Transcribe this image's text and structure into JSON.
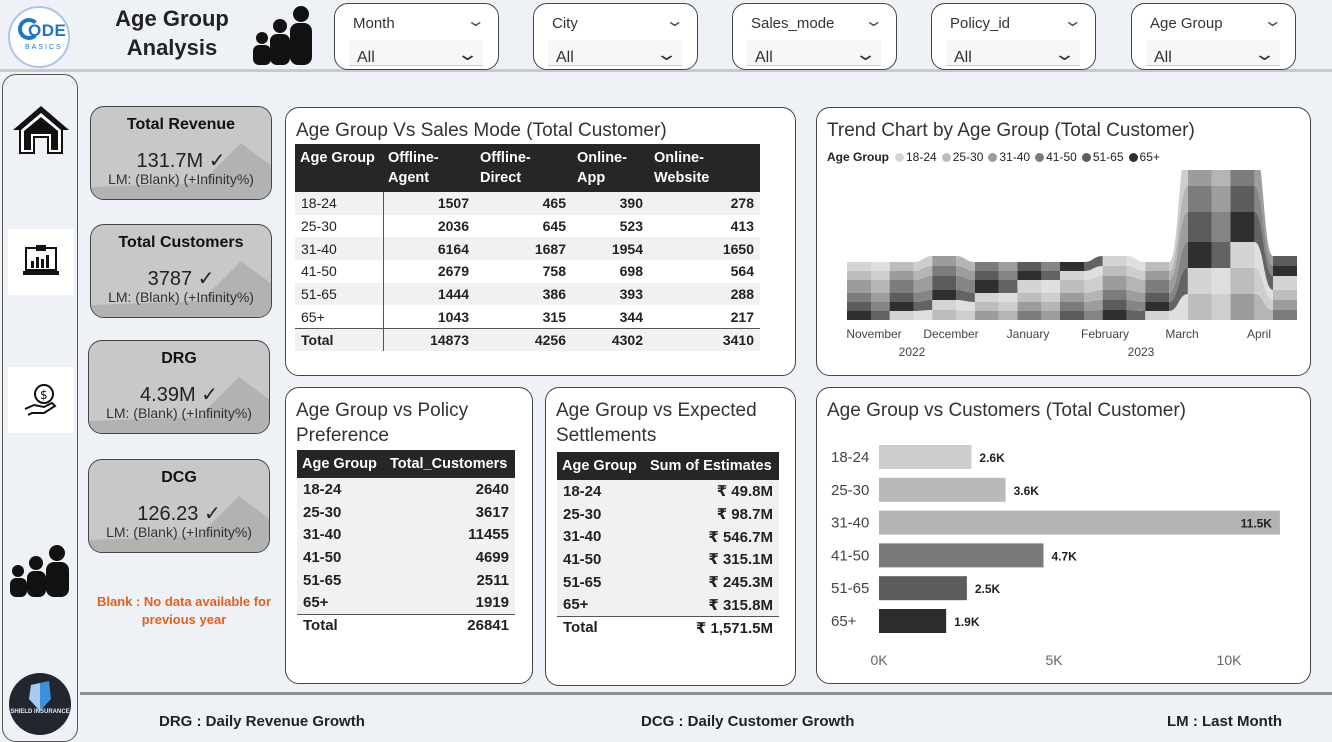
{
  "header": {
    "logo_text": "ODE",
    "logo_sub": "BASICS",
    "title": "Age Group Analysis",
    "slicers": [
      {
        "label": "Month",
        "value": "All"
      },
      {
        "label": "City",
        "value": "All"
      },
      {
        "label": "Sales_mode",
        "value": "All"
      },
      {
        "label": "Policy_id",
        "value": "All"
      },
      {
        "label": "Age Group",
        "value": "All"
      }
    ]
  },
  "sidebar": {
    "items": [
      {
        "icon": "home-icon"
      },
      {
        "icon": "kpi-dashboard-icon"
      },
      {
        "icon": "hand-money-icon"
      },
      {
        "icon": "age-group-icon"
      }
    ],
    "shield_label": "SHIELD INSURANCE"
  },
  "kpis": [
    {
      "title": "Total Revenue",
      "value": "131.7M",
      "lm": "LM: (Blank) (+Infinity%)"
    },
    {
      "title": "Total Customers",
      "value": "3787",
      "lm": "LM: (Blank) (+Infinity%)"
    },
    {
      "title": "DRG",
      "value": "4.39M",
      "lm": "LM: (Blank) (+Infinity%)"
    },
    {
      "title": "DCG",
      "value": "126.23",
      "lm": "LM: (Blank) (+Infinity%)"
    }
  ],
  "blank_note": "Blank : No data available for previous year",
  "sales_mode_table": {
    "title": "Age Group Vs Sales Mode (Total Customer)",
    "headers": [
      "Age Group",
      "Offline-Agent",
      "Offline-Direct",
      "Online-App",
      "Online-Website"
    ],
    "rows": [
      [
        "18-24",
        "1507",
        "465",
        "390",
        "278"
      ],
      [
        "25-30",
        "2036",
        "645",
        "523",
        "413"
      ],
      [
        "31-40",
        "6164",
        "1687",
        "1954",
        "1650"
      ],
      [
        "41-50",
        "2679",
        "758",
        "698",
        "564"
      ],
      [
        "51-65",
        "1444",
        "386",
        "393",
        "288"
      ],
      [
        "65+",
        "1043",
        "315",
        "344",
        "217"
      ]
    ],
    "total": [
      "Total",
      "14873",
      "4256",
      "4302",
      "3410"
    ]
  },
  "policy_table": {
    "title": "Age Group vs Policy Preference",
    "headers": [
      "Age Group",
      "Total_Customers"
    ],
    "rows": [
      [
        "18-24",
        "2640"
      ],
      [
        "25-30",
        "3617"
      ],
      [
        "31-40",
        "11455"
      ],
      [
        "41-50",
        "4699"
      ],
      [
        "51-65",
        "2511"
      ],
      [
        "65+",
        "1919"
      ]
    ],
    "total": [
      "Total",
      "26841"
    ]
  },
  "settlement_table": {
    "title": "Age Group vs Expected Settlements",
    "headers": [
      "Age Group",
      "Sum of Estimates"
    ],
    "rows": [
      [
        "18-24",
        "₹ 49.8M"
      ],
      [
        "25-30",
        "₹ 98.7M"
      ],
      [
        "31-40",
        "₹ 546.7M"
      ],
      [
        "41-50",
        "₹ 315.1M"
      ],
      [
        "51-65",
        "₹ 245.3M"
      ],
      [
        "65+",
        "₹ 315.8M"
      ]
    ],
    "total": [
      "Total",
      "₹ 1,571.5M"
    ]
  },
  "trend": {
    "title": "Trend Chart by Age Group (Total Customer)",
    "legend_title": "Age Group",
    "x_labels": [
      "November",
      "December",
      "January",
      "February",
      "March",
      "April"
    ],
    "year_labels": [
      "2022",
      "2023"
    ],
    "colors": [
      "#d4d4d4",
      "#bdbdbd",
      "#9c9c9c",
      "#7c7c7c",
      "#5c5c5c",
      "#2f2f2f"
    ]
  },
  "chart_data": {
    "type": "bar",
    "title": "Age Group vs Customers (Total Customer)",
    "categories": [
      "18-24",
      "25-30",
      "31-40",
      "41-50",
      "51-65",
      "65+"
    ],
    "values": [
      2640,
      3617,
      11455,
      4699,
      2511,
      1919
    ],
    "data_labels": [
      "2.6K",
      "3.6K",
      "11.5K",
      "4.7K",
      "2.5K",
      "1.9K"
    ],
    "colors": [
      "#cdcdcd",
      "#b9b9b9",
      "#b3b3b3",
      "#7a7a7a",
      "#5d5d5d",
      "#2c2c2c"
    ],
    "xticks": [
      "0K",
      "5K",
      "10K"
    ],
    "xtick_values": [
      0,
      5000,
      10000
    ],
    "xlim": [
      0,
      12000
    ],
    "legend": "none"
  },
  "footer": {
    "drg": "DRG : Daily Revenue Growth",
    "dcg": "DCG : Daily Customer Growth",
    "lm": "LM : Last Month"
  }
}
